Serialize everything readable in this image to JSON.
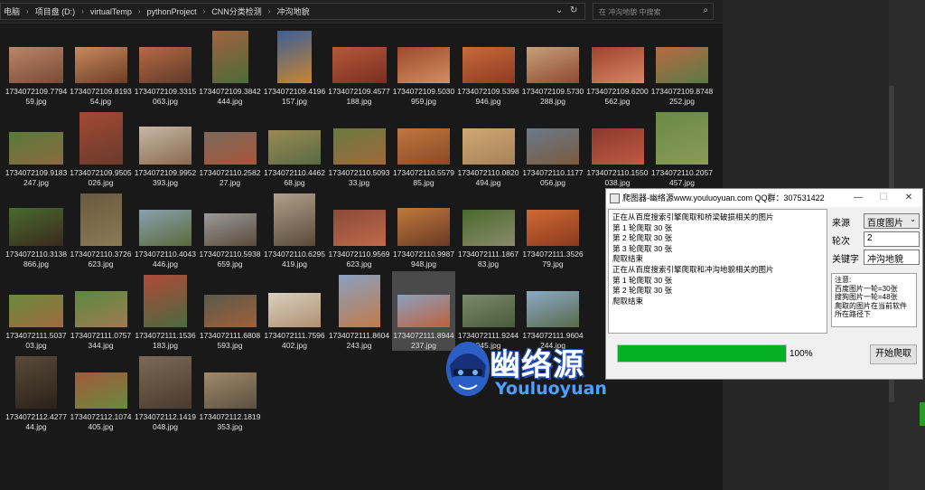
{
  "address_bar": {
    "crumbs": [
      "电脑",
      "项目盘 (D:)",
      "virtualTemp",
      "pythonProject",
      "CNN分类检测",
      "冲沟地貌"
    ],
    "search_placeholder": "在 冲沟地貌 中搜索"
  },
  "files": [
    {
      "name": "1734072109.779459.jpg",
      "colors": [
        "#b8866a",
        "#7a4a34"
      ]
    },
    {
      "name": "1734072109.819354.jpg",
      "colors": [
        "#c98a5e",
        "#6b3d25"
      ]
    },
    {
      "name": "1734072109.3315063.jpg",
      "colors": [
        "#b86a45",
        "#5e3a28"
      ]
    },
    {
      "name": "1734072109.3842444.jpg",
      "colors": [
        "#a2623f",
        "#4d6b3a"
      ]
    },
    {
      "name": "1734072109.4196157.jpg",
      "colors": [
        "#3b5f9a",
        "#c8852f"
      ]
    },
    {
      "name": "1734072109.4577188.jpg",
      "colors": [
        "#b55a3a",
        "#7a2e20"
      ]
    },
    {
      "name": "1734072109.5030959.jpg",
      "colors": [
        "#9e4a2c",
        "#d18e60"
      ]
    },
    {
      "name": "1734072109.5398946.jpg",
      "colors": [
        "#c76b3d",
        "#8f3a20"
      ]
    },
    {
      "name": "1734072109.5730288.jpg",
      "colors": [
        "#c7a07a",
        "#8e4a2e"
      ]
    },
    {
      "name": "1734072109.6200562.jpg",
      "colors": [
        "#a0432a",
        "#d6866a"
      ]
    },
    {
      "name": "1734072109.8748252.jpg",
      "colors": [
        "#b96a45",
        "#5a7a44"
      ]
    },
    {
      "name": "1734072109.9183247.jpg",
      "colors": [
        "#5a7a3a",
        "#8b6a40"
      ]
    },
    {
      "name": "1734072109.9505026.jpg",
      "colors": [
        "#a24a34",
        "#6b3a2c"
      ]
    },
    {
      "name": "1734072109.9952393.jpg",
      "colors": [
        "#c5b8a6",
        "#8a6a50"
      ]
    },
    {
      "name": "1734072110.258227.jpg",
      "colors": [
        "#7a6a5a",
        "#a8553a"
      ]
    },
    {
      "name": "1734072110.446268.jpg",
      "colors": [
        "#9a8a55",
        "#5a6a44"
      ]
    },
    {
      "name": "1734072110.509333.jpg",
      "colors": [
        "#6a7a3e",
        "#a0693e"
      ]
    },
    {
      "name": "1734072110.557985.jpg",
      "colors": [
        "#c0773f",
        "#8a4a28"
      ]
    },
    {
      "name": "1734072110.0820494.jpg",
      "colors": [
        "#d0a772",
        "#a5825a"
      ]
    },
    {
      "name": "1734072110.1177056.jpg",
      "colors": [
        "#6a7a8a",
        "#7a5a3e"
      ]
    },
    {
      "name": "1734072110.1550038.jpg",
      "colors": [
        "#8a3a2e",
        "#c05a44"
      ]
    },
    {
      "name": "1734072110.2057457.jpg",
      "colors": [
        "#6a8a44",
        "#8a9a5a"
      ]
    },
    {
      "name": "1734072110.3138866.jpg",
      "colors": [
        "#4a6a2e",
        "#3a2a1e"
      ]
    },
    {
      "name": "1734072110.3726623.jpg",
      "colors": [
        "#6a5a3e",
        "#8a7a55"
      ]
    },
    {
      "name": "1734072110.4043446.jpg",
      "colors": [
        "#8aa0b0",
        "#5a6a3a"
      ]
    },
    {
      "name": "1734072110.5938659.jpg",
      "colors": [
        "#9a9a9a",
        "#5a4a3a"
      ]
    },
    {
      "name": "1734072110.6295419.jpg",
      "colors": [
        "#b0a08a",
        "#5a4a3a"
      ]
    },
    {
      "name": "1734072110.9569623.jpg",
      "colors": [
        "#8a4a3a",
        "#c06a4a"
      ]
    },
    {
      "name": "1734072110.9987948.jpg",
      "colors": [
        "#c07a3e",
        "#6a3a24"
      ]
    },
    {
      "name": "1734072111.186783.jpg",
      "colors": [
        "#4a6a2e",
        "#8a8a6a"
      ]
    },
    {
      "name": "1734072111.352679.jpg",
      "colors": [
        "#d06a34",
        "#8a3a1e"
      ]
    },
    {
      "name": "1734072111.503703.jpg",
      "colors": [
        "#6a8a3e",
        "#a06a3e"
      ]
    },
    {
      "name": "1734072111.0757344.jpg",
      "colors": [
        "#5a8a3e",
        "#a07a55"
      ]
    },
    {
      "name": "1734072111.1536183.jpg",
      "colors": [
        "#b04a3a",
        "#4a6a3e"
      ]
    },
    {
      "name": "1734072111.6808593.jpg",
      "colors": [
        "#5a5a4a",
        "#a0603a"
      ]
    },
    {
      "name": "1734072111.7596402.jpg",
      "colors": [
        "#d8d0c0",
        "#b09070"
      ]
    },
    {
      "name": "1734072111.8604243.jpg",
      "colors": [
        "#8aa0c0",
        "#c07a4a"
      ]
    },
    {
      "name": "1734072111.8944237.jpg",
      "colors": [
        "#8aa0c0",
        "#c0603a"
      ],
      "selected": true
    },
    {
      "name": "1734072111.9244045.jpg",
      "colors": [
        "#7a8a6a",
        "#4a5a3a"
      ]
    },
    {
      "name": "1734072111.9604244.jpg",
      "colors": [
        "#8aaac8",
        "#5a6a4a"
      ]
    },
    {
      "name": "1734072112.427744.jpg",
      "colors": [
        "#5a4a3a",
        "#2a2218"
      ]
    },
    {
      "name": "1734072112.1074405.jpg",
      "colors": [
        "#a05a3a",
        "#6a8a3e"
      ]
    },
    {
      "name": "1734072112.1419048.jpg",
      "colors": [
        "#7a6a55",
        "#4a3a2e"
      ]
    },
    {
      "name": "1734072112.1819353.jpg",
      "colors": [
        "#a08a6a",
        "#5a5040"
      ]
    }
  ],
  "crawler_window": {
    "title": "爬图器-幽络源www.youluoyuan.com QQ群：307531422",
    "log_lines": [
      "正在从百度搜索引擎爬取和桥梁破损相关的图片",
      "第 1 轮爬取 30 张",
      "第 2 轮爬取 30 张",
      "第 3 轮爬取 30 张",
      "爬取结束",
      "正在从百度搜索引擎爬取和冲沟地貌相关的图片",
      "第 1 轮爬取 30 张",
      "第 2 轮爬取 30 张",
      "爬取结束"
    ],
    "source_label": "来源",
    "source_value": "百度图片",
    "rounds_label": "轮次",
    "rounds_value": "2",
    "keyword_label": "关键字",
    "keyword_value": "冲沟地貌",
    "notes": [
      "注意:",
      "百度图片一轮=30张",
      "搜狗图片一轮=48张",
      "爬取的图片在当前软件",
      "所在路径下"
    ],
    "progress": 1.0,
    "progress_text": "100%",
    "start_button": "开始爬取"
  },
  "watermark": {
    "cn": "幽络源",
    "en": "Youluoyuan"
  },
  "colors": {
    "progress_fill": "#06b025",
    "explorer_bg": "#191919"
  }
}
